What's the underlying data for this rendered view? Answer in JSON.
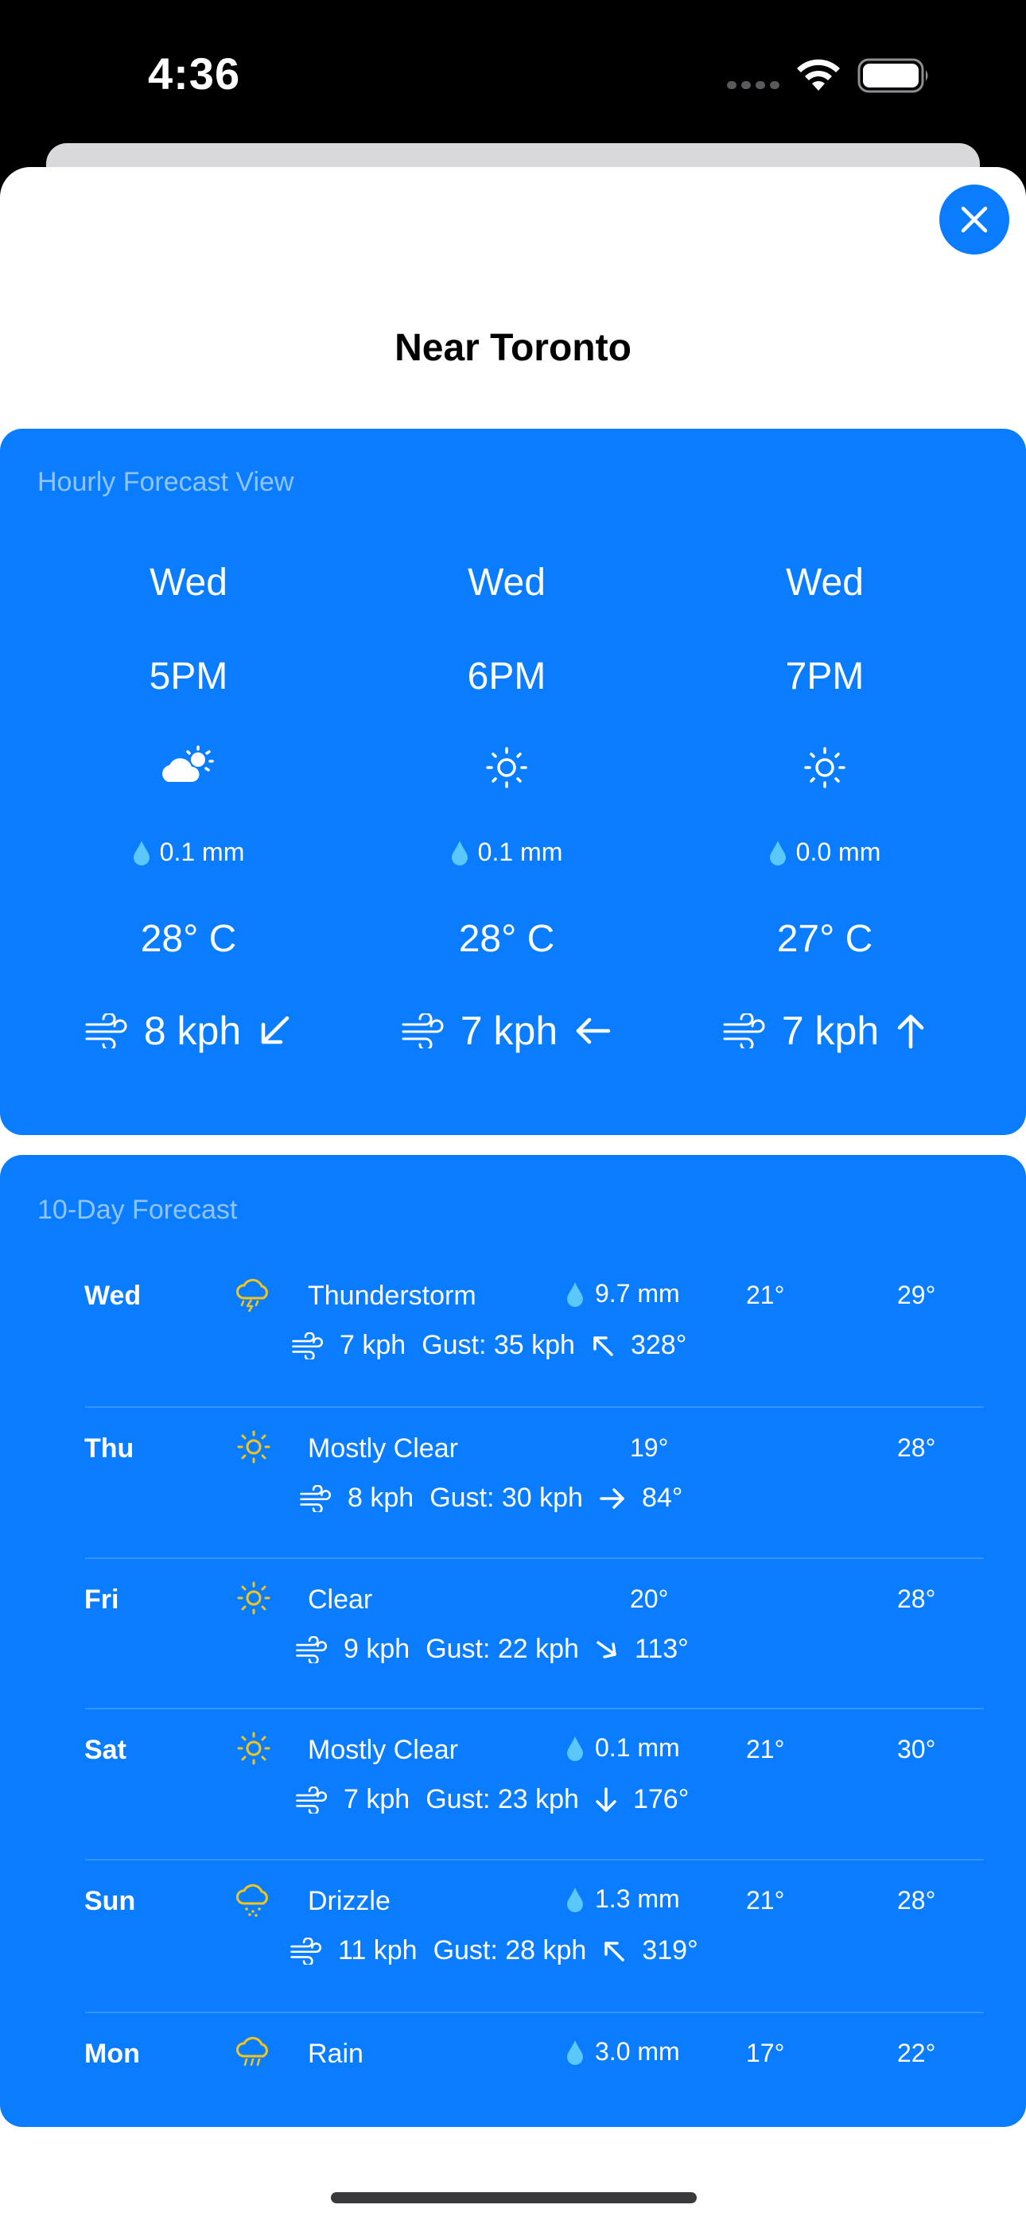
{
  "status_bar": {
    "time": "4:36"
  },
  "sheet": {
    "title": "Near Toronto"
  },
  "hourly": {
    "heading": "Hourly Forecast View",
    "items": [
      {
        "day": "Wed",
        "time": "5PM",
        "icon": "partly-cloudy-icon",
        "precip": "0.1 mm",
        "temp": "28° C",
        "wind": "8 kph",
        "wind_dir_icon": "arrow-down-left-icon"
      },
      {
        "day": "Wed",
        "time": "6PM",
        "icon": "sun-icon",
        "precip": "0.1 mm",
        "temp": "28° C",
        "wind": "7 kph",
        "wind_dir_icon": "arrow-left-icon"
      },
      {
        "day": "Wed",
        "time": "7PM",
        "icon": "sun-icon",
        "precip": "0.0 mm",
        "temp": "27° C",
        "wind": "7 kph",
        "wind_dir_icon": "arrow-up-icon"
      }
    ]
  },
  "daily": {
    "heading": "10-Day Forecast",
    "rows": [
      {
        "day": "Wed",
        "icon": "thunderstorm-icon",
        "condition": "Thunderstorm",
        "precip": "9.7 mm",
        "low": "21°",
        "high": "29°",
        "wind": "7 kph",
        "gust": "Gust: 35 kph",
        "dir_icon": "arrow-up-left-icon",
        "degrees": "328°"
      },
      {
        "day": "Thu",
        "icon": "sun-icon",
        "condition": "Mostly Clear",
        "precip": "",
        "low": "19°",
        "high": "28°",
        "wind": "8 kph",
        "gust": "Gust: 30 kph",
        "dir_icon": "arrow-right-icon",
        "degrees": "84°"
      },
      {
        "day": "Fri",
        "icon": "sun-icon",
        "condition": "Clear",
        "precip": "",
        "low": "20°",
        "high": "28°",
        "wind": "9 kph",
        "gust": "Gust: 22 kph",
        "dir_icon": "arrow-down-right-icon",
        "degrees": "113°"
      },
      {
        "day": "Sat",
        "icon": "sun-icon",
        "condition": "Mostly Clear",
        "precip": "0.1 mm",
        "low": "21°",
        "high": "30°",
        "wind": "7 kph",
        "gust": "Gust: 23 kph",
        "dir_icon": "arrow-down-icon",
        "degrees": "176°"
      },
      {
        "day": "Sun",
        "icon": "drizzle-icon",
        "condition": "Drizzle",
        "precip": "1.3 mm",
        "low": "21°",
        "high": "28°",
        "wind": "11 kph",
        "gust": "Gust: 28 kph",
        "dir_icon": "arrow-up-left-icon",
        "degrees": "319°"
      },
      {
        "day": "Mon",
        "icon": "rain-icon",
        "condition": "Rain",
        "precip": "3.0 mm",
        "low": "17°",
        "high": "22°"
      }
    ]
  },
  "colors": {
    "accent": "#0a7cff",
    "icon_yellow": "#f5c518"
  }
}
